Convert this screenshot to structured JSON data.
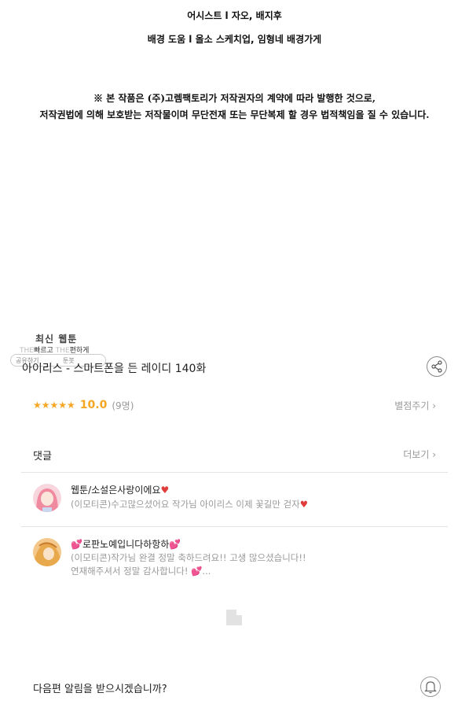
{
  "credits": {
    "line1": "어시스트 l 자오, 배지후",
    "line2": "배경 도움 l 올소 스케치업, 임형네 배경가게"
  },
  "notice": {
    "line1": "※ 본 작품은 (주)고렘팩토리가 저작권자의 계약에 따라 발행한 것으로,",
    "line2": "저작권법에 의해 보호받는 저작물이며 무단전재 또는 무단복제 할 경우 법적책임을 질 수 있습니다."
  },
  "overlay": {
    "title": "최신 웹툰",
    "sub_a_faint": "THE",
    "sub_a": "빠르고",
    "sub_b_faint": "THE",
    "sub_b": "편하게",
    "bar_a": "공유하기",
    "bar_b": "툰봇"
  },
  "episode": {
    "title": "아이리스 - 스마트폰을 든 레이디 140화"
  },
  "rating": {
    "stars": "★★★★★",
    "score": "10.0",
    "votes": "(9명)",
    "rate_label": "별점주기 ›"
  },
  "comments": {
    "header": "댓글",
    "more_label": "더보기 ›",
    "items": [
      {
        "name": "웹툰/소설은사랑이에요",
        "line1": "(이모티콘)수고많으셨어요 작가님 아이리스 이제 꽃길만 걷자"
      },
      {
        "name": "로판노예입니다하항하",
        "line1": "(이모티콘)작가님 완결 정말 축하드려요!! 고생 많으셨습니다!!",
        "line2": "연재해주셔서 정말 감사합니다! 💕..."
      }
    ]
  },
  "alert": {
    "question": "다음편 알림을 받으시겠습니까?"
  },
  "icons": {
    "share": "share-icon",
    "bell": "bell-icon",
    "star": "star-icon",
    "loader": "loading-icon"
  },
  "colors": {
    "accent": "#f5a623",
    "heart": "#e03c3c",
    "muted": "#999999"
  }
}
